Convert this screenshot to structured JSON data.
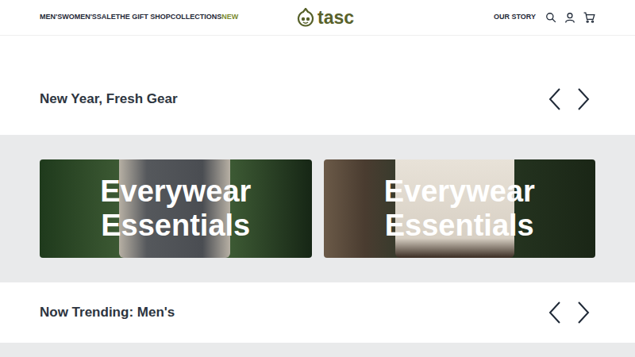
{
  "header": {
    "nav": [
      {
        "label": "MEN'S",
        "highlighted": false
      },
      {
        "label": "WOMEN'S",
        "highlighted": false
      },
      {
        "label": "SALE",
        "highlighted": false
      },
      {
        "label": "THE GIFT SHOP",
        "highlighted": false
      },
      {
        "label": "COLLECTIONS",
        "highlighted": false
      },
      {
        "label": "NEW",
        "highlighted": true
      }
    ],
    "logo": "tasc",
    "right_link": "OUR STORY"
  },
  "sections": [
    {
      "title": "New Year, Fresh Gear"
    },
    {
      "title": "Now Trending: Men's"
    }
  ],
  "cards": [
    {
      "title_line1": "Everywear",
      "title_line2": "Essentials",
      "kind": "men"
    },
    {
      "title_line1": "Everywear",
      "title_line2": "Essentials",
      "kind": "women"
    }
  ]
}
